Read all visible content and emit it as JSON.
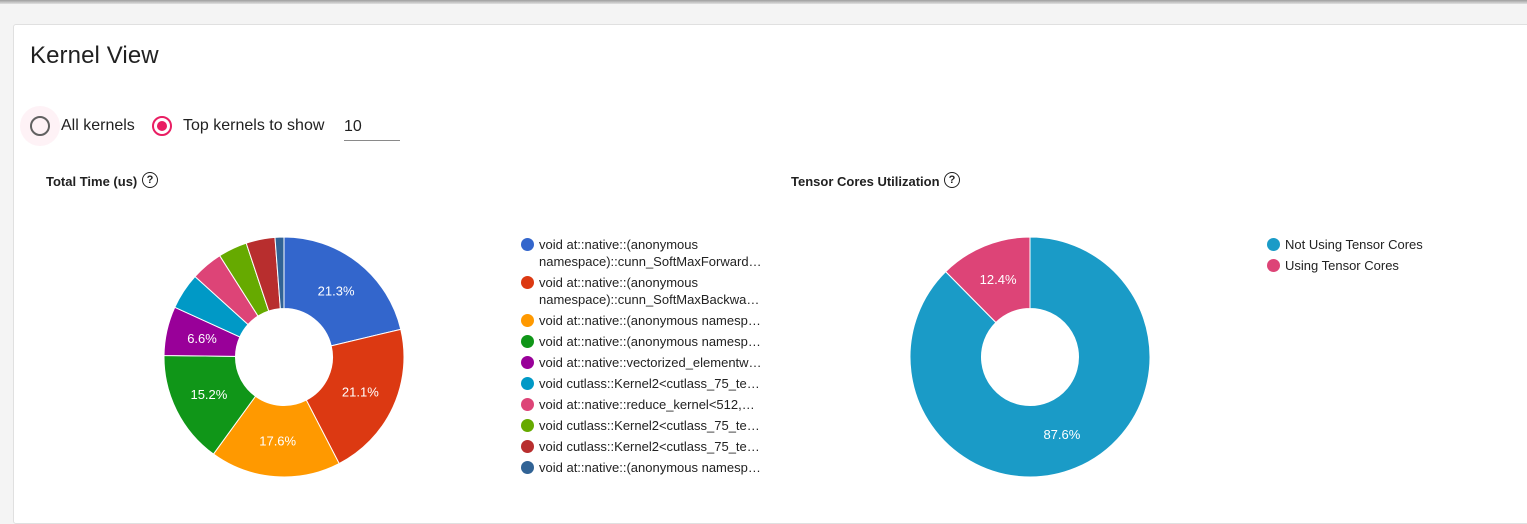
{
  "page": {
    "title": "Kernel View",
    "filter": {
      "options": [
        {
          "label": "All kernels",
          "selected": false
        },
        {
          "label": "Top kernels to show",
          "selected": true
        }
      ],
      "top_k_value": "10"
    },
    "accent_color": "#e91e63"
  },
  "help_icon_glyph": "?",
  "chart_data": [
    {
      "type": "pie",
      "title": "Total Time (us)",
      "donut": true,
      "legend_position": "right",
      "slices": [
        {
          "label": [
            "void at::native::(anonymous",
            "namespace)::cunn_SoftMaxForward…"
          ],
          "value": 21.3,
          "data_label": "21.3%",
          "color": "#3366cc"
        },
        {
          "label": [
            "void at::native::(anonymous",
            "namespace)::cunn_SoftMaxBackwa…"
          ],
          "value": 21.1,
          "data_label": "21.1%",
          "color": "#dc3912"
        },
        {
          "label": [
            "void at::native::(anonymous namesp…"
          ],
          "value": 17.6,
          "data_label": "17.6%",
          "color": "#ff9900"
        },
        {
          "label": [
            "void at::native::(anonymous namesp…"
          ],
          "value": 15.2,
          "data_label": "15.2%",
          "color": "#109618"
        },
        {
          "label": [
            "void at::native::vectorized_elementw…"
          ],
          "value": 6.6,
          "data_label": "6.6%",
          "color": "#990099"
        },
        {
          "label": [
            "void cutlass::Kernel2<cutlass_75_te…"
          ],
          "value": 4.9,
          "data_label": "",
          "color": "#0099c6"
        },
        {
          "label": [
            "void at::native::reduce_kernel<512,…"
          ],
          "value": 4.3,
          "data_label": "",
          "color": "#dd4477"
        },
        {
          "label": [
            "void cutlass::Kernel2<cutlass_75_te…"
          ],
          "value": 3.9,
          "data_label": "",
          "color": "#66aa00"
        },
        {
          "label": [
            "void cutlass::Kernel2<cutlass_75_te…"
          ],
          "value": 3.9,
          "data_label": "",
          "color": "#b82e2e"
        },
        {
          "label": [
            "void at::native::(anonymous namesp…"
          ],
          "value": 1.2,
          "data_label": "",
          "color": "#316395"
        }
      ]
    },
    {
      "type": "pie",
      "title": "Tensor Cores Utilization",
      "donut": true,
      "legend_position": "right",
      "slices": [
        {
          "label": [
            "Not Using Tensor Cores"
          ],
          "value": 87.6,
          "data_label": "87.6%",
          "color": "#1a9bc7"
        },
        {
          "label": [
            "Using Tensor Cores"
          ],
          "value": 12.4,
          "data_label": "12.4%",
          "color": "#dd4477"
        }
      ]
    }
  ]
}
